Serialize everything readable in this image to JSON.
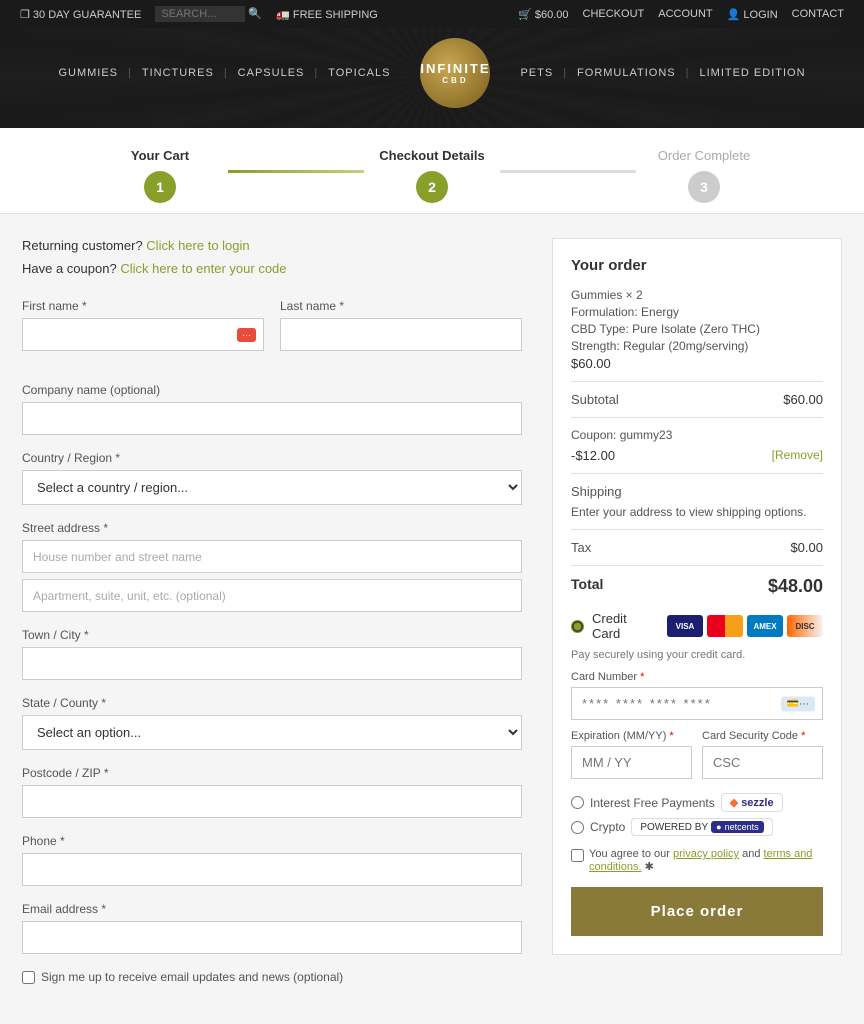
{
  "topbar": {
    "guarantee": "30 DAY GUARANTEE",
    "search_placeholder": "SEARCH...",
    "free_shipping": "FREE SHIPPING",
    "cart_amount": "$60.00",
    "checkout_link": "CHECKOUT",
    "account_link": "ACCOUNT",
    "login_link": "LOGIN",
    "contact_link": "CONTACT"
  },
  "nav": {
    "items": [
      "GUMMIES",
      "TINCTURES",
      "CAPSULES",
      "TOPICALS",
      "PETS",
      "FORMULATIONS",
      "LIMITED EDITION"
    ],
    "logo_line1": "iNFiNiTE",
    "logo_line2": "CBD"
  },
  "steps": [
    {
      "label": "Your Cart",
      "number": "1",
      "active": true
    },
    {
      "label": "Checkout Details",
      "number": "2",
      "active": true
    },
    {
      "label": "Order Complete",
      "number": "3",
      "active": false
    }
  ],
  "returning": {
    "text": "Returning customer?",
    "link": "Click here to login"
  },
  "coupon": {
    "text": "Have a coupon?",
    "link": "Click here to enter your code"
  },
  "form": {
    "first_name_label": "First name *",
    "last_name_label": "Last name *",
    "company_label": "Company name (optional)",
    "country_label": "Country / Region *",
    "country_placeholder": "Select a country / region...",
    "street_label": "Street address *",
    "street_placeholder": "House number and street name",
    "apt_placeholder": "Apartment, suite, unit, etc. (optional)",
    "city_label": "Town / City *",
    "state_label": "State / County *",
    "state_placeholder": "Select an option...",
    "postcode_label": "Postcode / ZIP *",
    "phone_label": "Phone *",
    "email_label": "Email address *",
    "signup_label": "Sign me up to receive email updates and news (optional)"
  },
  "order": {
    "title": "Your order",
    "product_name": "Gummies × 2",
    "product_detail1": "Formulation:  Energy",
    "product_detail2": "CBD Type: Pure Isolate (Zero THC)",
    "product_detail3": "Strength: Regular (20mg/serving)",
    "product_price": "$60.00",
    "subtotal_label": "Subtotal",
    "subtotal_value": "$60.00",
    "coupon_label": "Coupon: gummy23",
    "coupon_value": "-$12.00",
    "remove_link": "[Remove]",
    "shipping_label": "Shipping",
    "shipping_value": "Enter your address to view shipping options.",
    "tax_label": "Tax",
    "tax_value": "$0.00",
    "total_label": "Total",
    "total_value": "$48.00"
  },
  "payment": {
    "credit_card_label": "Credit Card",
    "secure_text": "Pay securely using your credit card.",
    "card_number_label": "Card Number",
    "card_number_placeholder": "**** **** **** ****",
    "expiry_label": "Expiration (MM/YY)",
    "expiry_placeholder": "MM / YY",
    "csc_label": "Card Security Code",
    "csc_placeholder": "CSC",
    "sezzle_label": "Interest Free Payments",
    "sezzle_logo": "sezzle",
    "crypto_label": "Crypto",
    "netcents_prefix": "POWERED BY",
    "netcents_logo": "netcents",
    "terms_text": "You agree to our",
    "privacy_link": "privacy policy",
    "and_text": "and",
    "terms_link": "terms and conditions.",
    "place_order_label": "Place order"
  }
}
